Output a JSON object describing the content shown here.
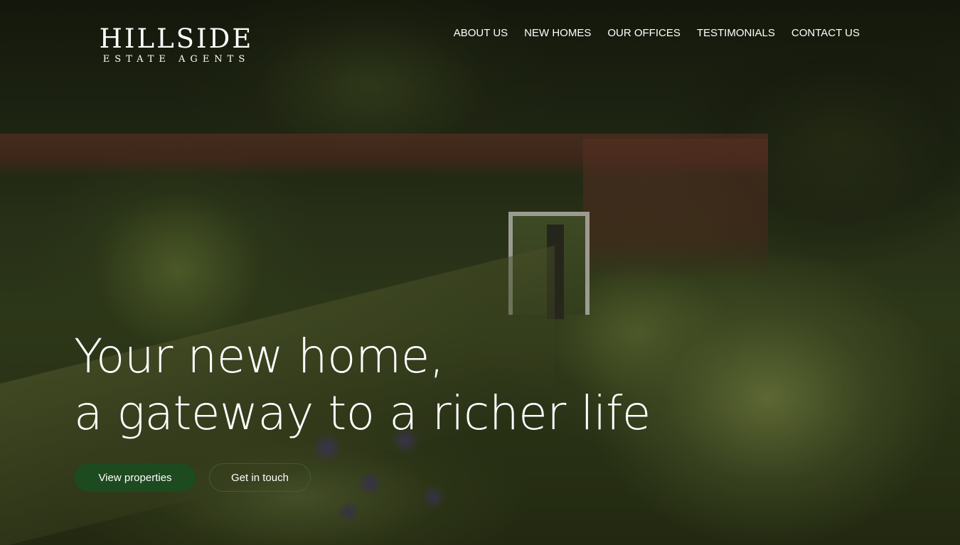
{
  "brand": {
    "name": "HILLSIDE",
    "tagline": "ESTATE AGENTS"
  },
  "nav": {
    "items": [
      {
        "label": "ABOUT US"
      },
      {
        "label": "NEW HOMES"
      },
      {
        "label": "OUR OFFICES"
      },
      {
        "label": "TESTIMONIALS"
      },
      {
        "label": "CONTACT US"
      }
    ]
  },
  "hero": {
    "headline_line1": "Your new home,",
    "headline_line2": "a gateway to a richer life",
    "primary_button": "View properties",
    "secondary_button": "Get in touch",
    "background_image": "garden-with-brick-wall-and-doorway"
  },
  "colors": {
    "primary_button": "#1d4a1f",
    "text": "#ffffff"
  }
}
